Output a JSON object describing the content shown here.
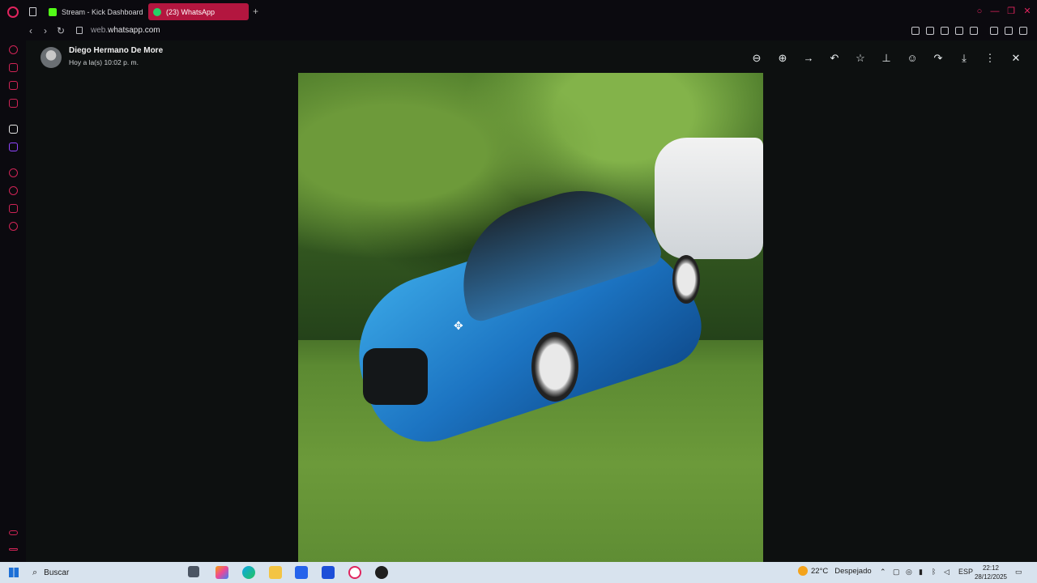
{
  "browser": {
    "tabs": [
      {
        "label": "Stream - Kick Dashboard"
      },
      {
        "label": "(23) WhatsApp"
      }
    ],
    "new_tab": "+",
    "url_host": "web.",
    "url_domain": "whatsapp.com"
  },
  "viewer": {
    "sender_name": "Diego Hermano De More",
    "timestamp": "Hoy a la(s) 10:02 p. m.",
    "actions": [
      {
        "icon": "zoom-out-icon",
        "glyph": "⊖"
      },
      {
        "icon": "zoom-in-icon",
        "glyph": "⊕"
      },
      {
        "icon": "go-to-message-icon",
        "glyph": "→"
      },
      {
        "icon": "reply-icon",
        "glyph": "↶"
      },
      {
        "icon": "star-icon",
        "glyph": "☆"
      },
      {
        "icon": "pin-icon",
        "glyph": "⊥"
      },
      {
        "icon": "react-emoji-icon",
        "glyph": "☺"
      },
      {
        "icon": "forward-icon",
        "glyph": "↷"
      },
      {
        "icon": "download-icon",
        "glyph": "⤓"
      },
      {
        "icon": "more-menu-icon",
        "glyph": "⋮"
      },
      {
        "icon": "close-icon",
        "glyph": "✕"
      }
    ]
  },
  "taskbar": {
    "search_placeholder": "Buscar",
    "weather_temp": "22°C",
    "weather_desc": "Despejado",
    "language": "ESP",
    "time": "22:12",
    "date": "28/12/2025"
  },
  "colors": {
    "opera_accent": "#e0245e",
    "active_tab": "#b3163f",
    "viewer_bg": "#0d1010",
    "taskbar_bg": "#d8e3ee"
  }
}
